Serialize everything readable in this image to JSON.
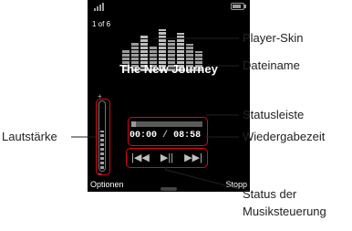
{
  "phone": {
    "track_count": "1 of 6",
    "song_title": "The New Journey",
    "time_elapsed": "00:00",
    "time_separator": "/",
    "time_total": "08:58",
    "progress_fraction": 0.06,
    "volume_fraction": 0.55,
    "vol_plus": "+",
    "vol_minus": "−",
    "controls": {
      "prev": "|◀◀",
      "play_pause": "▶||",
      "next": "▶▶|"
    },
    "softkeys": {
      "left": "Optionen",
      "right": "Stopp"
    }
  },
  "labels": {
    "player_skin": "Player-Skin",
    "dateiname": "Dateiname",
    "statusleiste": "Statusleiste",
    "wiedergabezeit": "Wiedergabezeit",
    "lautstaerke": "Lautstärke",
    "status_line1": "Status der",
    "status_line2": "Musiksteuerung"
  },
  "colors": {
    "callout": "#e30613",
    "screen_bg": "#000000"
  },
  "icons": {
    "signal": "signal-strength-icon",
    "battery": "battery-icon",
    "previous": "previous-track-icon",
    "play_pause": "play-pause-icon",
    "next": "next-track-icon"
  }
}
